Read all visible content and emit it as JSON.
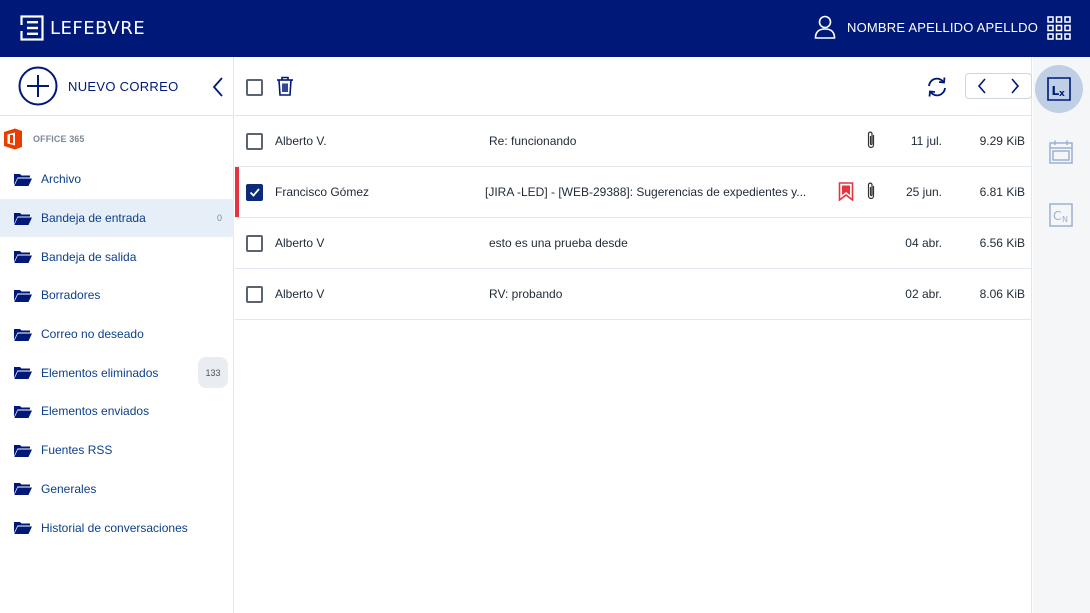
{
  "header": {
    "logo_text": "LEFEBVRE",
    "user_name": "NOMBRE APELLIDO APELLDO",
    "bg_color": "#001978"
  },
  "sidebar": {
    "compose_label": "NUEVO CORREO",
    "account_label": "OFFICE 365",
    "folders": [
      {
        "label": "Archivo",
        "count": ""
      },
      {
        "label": "Bandeja de entrada",
        "count": "0",
        "active": true
      },
      {
        "label": "Bandeja de salida",
        "count": ""
      },
      {
        "label": "Borradores",
        "count": ""
      },
      {
        "label": "Correo no deseado",
        "count": ""
      },
      {
        "label": "Elementos eliminados",
        "count": "133"
      },
      {
        "label": "Elementos enviados",
        "count": ""
      },
      {
        "label": "Fuentes RSS",
        "count": ""
      },
      {
        "label": "Generales",
        "count": ""
      },
      {
        "label": "Historial de conversaciones",
        "count": ""
      }
    ]
  },
  "messages": [
    {
      "from": "Alberto V.",
      "subject": "Re: funcionando",
      "date": "11 jul.",
      "size": "9.29 KiB",
      "checked": false,
      "flagged": false,
      "attachment": true
    },
    {
      "from": "Francisco Gómez",
      "subject": "[JIRA -LED] - [WEB-29388]: Sugerencias de expedientes y...",
      "date": "25 jun.",
      "size": "6.81 KiB",
      "checked": true,
      "flagged": true,
      "attachment": true
    },
    {
      "from": "Alberto V",
      "subject": "esto es una prueba desde",
      "date": "04 abr.",
      "size": "6.56 KiB",
      "checked": false,
      "flagged": false,
      "attachment": false
    },
    {
      "from": "Alberto V",
      "subject": "RV: probando",
      "date": "02 abr.",
      "size": "8.06 KiB",
      "checked": false,
      "flagged": false,
      "attachment": false
    }
  ],
  "rail": {
    "lx_label": "Lx",
    "cn_label": "CN"
  },
  "colors": {
    "accent": "#001978",
    "link": "#0c3f8c",
    "flag": "#e5333f",
    "office": "#eb3c00"
  }
}
